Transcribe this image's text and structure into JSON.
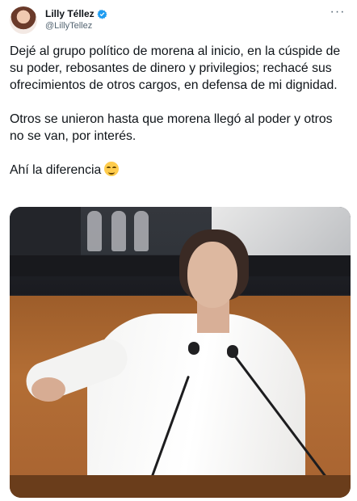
{
  "author": {
    "display_name": "Lilly Téllez",
    "handle": "@LillyTellez",
    "avatar_icon": "profile-photo",
    "verified_icon": "verified-badge-icon",
    "verified_color": "#1d9bf0"
  },
  "tweet": {
    "paragraph_1": "Dejé al grupo político de morena al inicio, en la cúspide de su poder, rebosantes de dinero y privilegios; rechacé sus ofrecimientos de otros cargos, en defensa de mi dignidad.",
    "paragraph_2": "Otros se unieron hasta que morena llegó al poder y otros no se van, por interés.",
    "paragraph_3": "Ahí la diferencia",
    "emoji_icon": "relieved-face-emoji"
  },
  "media": {
    "icon": "photo-of-woman-speaking"
  }
}
